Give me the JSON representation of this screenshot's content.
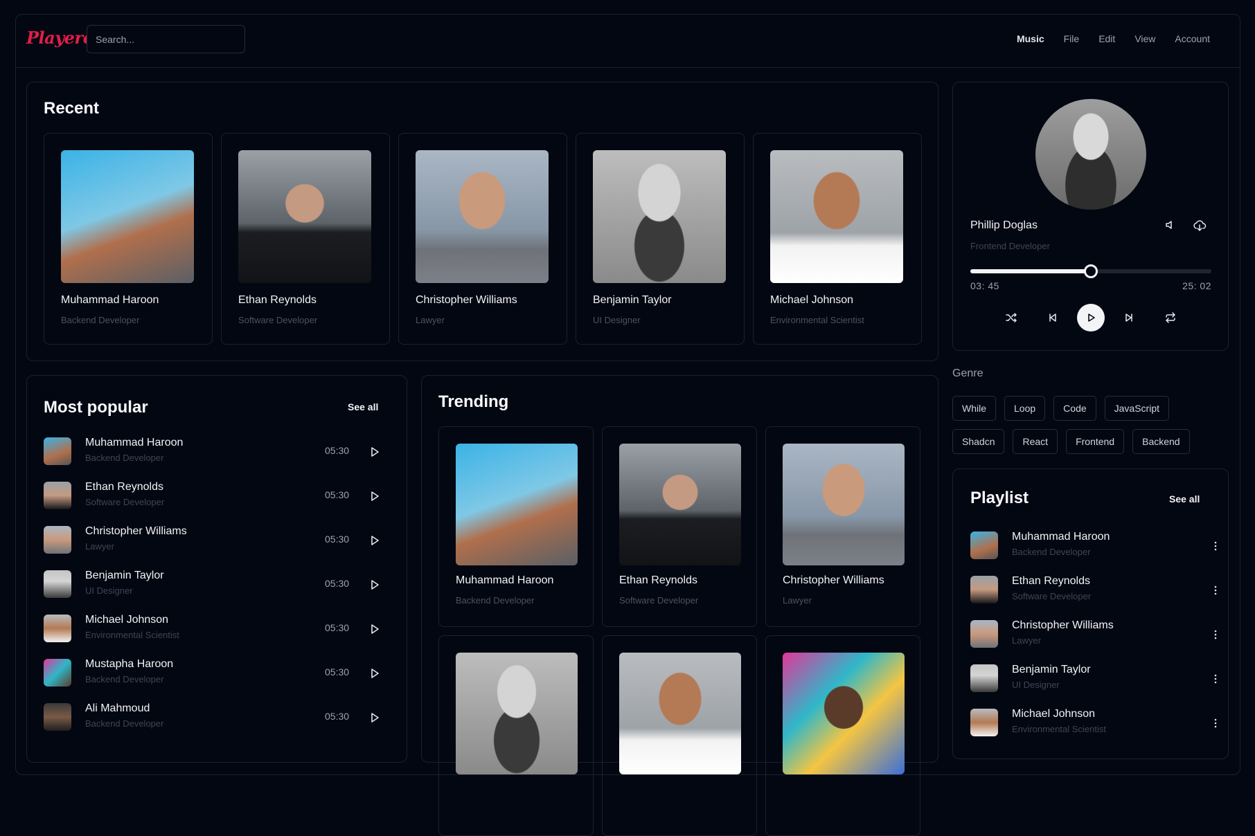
{
  "app": {
    "logo": "Playero"
  },
  "search": {
    "placeholder": "Search..."
  },
  "menu": {
    "items": [
      "Music",
      "File",
      "Edit",
      "View",
      "Account"
    ],
    "active": "Music"
  },
  "recent": {
    "title": "Recent",
    "items": [
      {
        "name": "Muhammad Haroon",
        "role": "Backend Developer"
      },
      {
        "name": "Ethan Reynolds",
        "role": "Software Developer"
      },
      {
        "name": "Christopher Williams",
        "role": "Lawyer"
      },
      {
        "name": "Benjamin Taylor",
        "role": "UI Designer"
      },
      {
        "name": "Michael Johnson",
        "role": "Environmental Scientist"
      }
    ]
  },
  "popular": {
    "title": "Most popular",
    "see_all": "See all",
    "items": [
      {
        "name": "Muhammad Haroon",
        "role": "Backend Developer",
        "time": "05:30"
      },
      {
        "name": "Ethan Reynolds",
        "role": "Software Developer",
        "time": "05:30"
      },
      {
        "name": "Christopher Williams",
        "role": "Lawyer",
        "time": "05:30"
      },
      {
        "name": "Benjamin Taylor",
        "role": "UI Designer",
        "time": "05:30"
      },
      {
        "name": "Michael Johnson",
        "role": "Environmental Scientist",
        "time": "05:30"
      },
      {
        "name": "Mustapha Haroon",
        "role": "Backend Developer",
        "time": "05:30"
      },
      {
        "name": "Ali Mahmoud",
        "role": "Backend Developer",
        "time": "05:30"
      }
    ]
  },
  "trending": {
    "title": "Trending",
    "items": [
      {
        "name": "Muhammad Haroon",
        "role": "Backend Developer"
      },
      {
        "name": "Ethan Reynolds",
        "role": "Software Developer"
      },
      {
        "name": "Christopher Williams",
        "role": "Lawyer"
      }
    ]
  },
  "player": {
    "name": "Phillip Doglas",
    "role": "Frontend Developer",
    "current_time": "03: 45",
    "total_time": "25: 02",
    "progress": 0.5
  },
  "genre": {
    "label": "Genre",
    "chips": [
      "While",
      "Loop",
      "Code",
      "JavaScript",
      "Shadcn",
      "React",
      "Frontend",
      "Backend"
    ]
  },
  "playlist": {
    "title": "Playlist",
    "see_all": "See all",
    "items": [
      {
        "name": "Muhammad Haroon",
        "role": "Backend Developer"
      },
      {
        "name": "Ethan Reynolds",
        "role": "Software Developer"
      },
      {
        "name": "Christopher Williams",
        "role": "Lawyer"
      },
      {
        "name": "Benjamin Taylor",
        "role": "UI Designer"
      },
      {
        "name": "Michael Johnson",
        "role": "Environmental Scientist"
      }
    ]
  }
}
